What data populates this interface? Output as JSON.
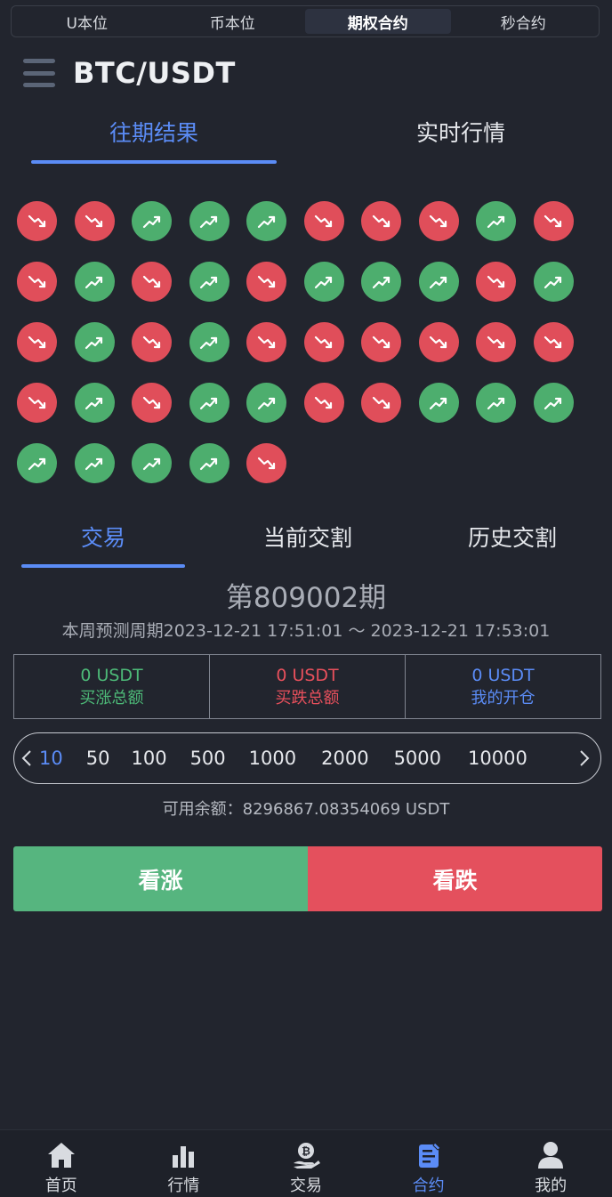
{
  "top_tabs": [
    "U本位",
    "币本位",
    "期权合约",
    "秒合约"
  ],
  "top_tabs_active": 2,
  "pair": "BTC/USDT",
  "view_tabs": {
    "history": "往期结果",
    "realtime": "实时行情"
  },
  "results": [
    "down",
    "down",
    "up",
    "up",
    "up",
    "down",
    "down",
    "down",
    "up",
    "down",
    "down",
    "up",
    "down",
    "up",
    "down",
    "up",
    "up",
    "up",
    "down",
    "up",
    "down",
    "up",
    "down",
    "up",
    "down",
    "down",
    "down",
    "down",
    "down",
    "down",
    "down",
    "up",
    "down",
    "up",
    "up",
    "down",
    "down",
    "up",
    "up",
    "up",
    "up",
    "up",
    "up",
    "up",
    "down"
  ],
  "trade_tabs": {
    "trade": "交易",
    "current": "当前交割",
    "history": "历史交割"
  },
  "period": "第809002期",
  "cycle": "本周预测周期2023-12-21 17:51:01 ～ 2023-12-21 17:53:01",
  "stats": {
    "buy_up_value": "0 USDT",
    "buy_up_label": "买涨总额",
    "buy_down_value": "0 USDT",
    "buy_down_label": "买跌总额",
    "my_open_value": "0 USDT",
    "my_open_label": "我的开仓"
  },
  "amounts": [
    "10",
    "50",
    "100",
    "500",
    "1000",
    "2000",
    "5000",
    "10000"
  ],
  "amount_selected": "10",
  "balance": "可用余额：8296867.08354069 USDT",
  "buttons": {
    "up": "看涨",
    "down": "看跌"
  },
  "nav": {
    "home": "首页",
    "market": "行情",
    "trade": "交易",
    "contract": "合约",
    "mine": "我的"
  },
  "nav_active": "contract",
  "colors": {
    "accent": "#5b8cf6",
    "up": "#4dae6e",
    "down": "#e04e5a"
  }
}
